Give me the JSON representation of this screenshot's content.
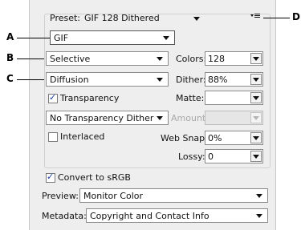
{
  "callouts": {
    "a": "A",
    "b": "B",
    "c": "C",
    "d": "D"
  },
  "preset": {
    "label": "Preset:",
    "value": "GIF 128 Dithered"
  },
  "format": {
    "value": "GIF"
  },
  "color_reduction": {
    "value": "Selective"
  },
  "colors": {
    "label": "Colors:",
    "value": "128"
  },
  "dither_algorithm": {
    "value": "Diffusion"
  },
  "dither": {
    "label": "Dither:",
    "value": "88%"
  },
  "transparency": {
    "label": "Transparency",
    "checked": true
  },
  "matte": {
    "label": "Matte:",
    "value": ""
  },
  "transparency_dither": {
    "value": "No Transparency Dither"
  },
  "amount": {
    "label": "Amount:",
    "value": ""
  },
  "interlaced": {
    "label": "Interlaced",
    "checked": false
  },
  "web_snap": {
    "label": "Web Snap:",
    "value": "0%"
  },
  "lossy": {
    "label": "Lossy:",
    "value": "0"
  },
  "convert_srgb": {
    "label": "Convert to sRGB",
    "checked": true
  },
  "preview": {
    "label": "Preview:",
    "value": "Monitor Color"
  },
  "metadata": {
    "label": "Metadata:",
    "value": "Copyright and Contact Info"
  },
  "icons": {
    "menu": "panel-menu-icon",
    "check": "checkmark-icon",
    "dropdown": "chevron-down-icon"
  }
}
